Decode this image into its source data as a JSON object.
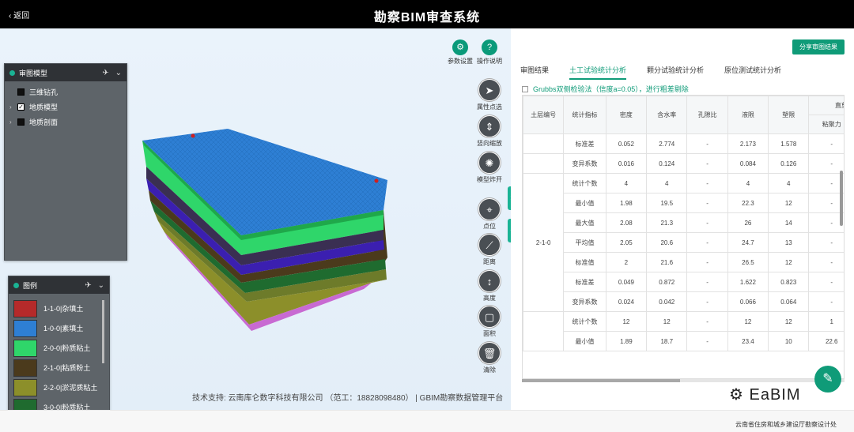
{
  "header": {
    "back_label": "返回",
    "title": "勘察BIM审查系统"
  },
  "model_panel": {
    "title": "审图模型",
    "items": [
      {
        "label": "三维钻孔",
        "checked": false,
        "expandable": false
      },
      {
        "label": "地质模型",
        "checked": true,
        "expandable": true
      },
      {
        "label": "地质剖面",
        "checked": false,
        "expandable": true
      }
    ]
  },
  "legend_panel": {
    "title": "图例",
    "items": [
      {
        "label": "1-1-0|杂填土",
        "color": "#b52a2a"
      },
      {
        "label": "1-0-0|素填土",
        "color": "#2e7fd4"
      },
      {
        "label": "2-0-0|粉质粘土",
        "color": "#2fd66a"
      },
      {
        "label": "2-1-0|粘质粉土",
        "color": "#4b3a1c"
      },
      {
        "label": "2-2-0|淤泥质粘土",
        "color": "#8c8f2a"
      },
      {
        "label": "3-0-0|粉质粘土",
        "color": "#1f6b2f"
      }
    ]
  },
  "toolbar_top": [
    {
      "label": "参数设置",
      "icon": "gear-icon"
    },
    {
      "label": "操作说明",
      "icon": "help-icon"
    }
  ],
  "toolbar": [
    {
      "label": "属性点选",
      "icon": "pointer-icon"
    },
    {
      "label": "竖向缩放",
      "icon": "vertical-scale-icon"
    },
    {
      "label": "模型炸开",
      "icon": "explode-icon"
    },
    {
      "label": "点位",
      "icon": "point-icon"
    },
    {
      "label": "距离",
      "icon": "distance-icon"
    },
    {
      "label": "高度",
      "icon": "height-icon"
    },
    {
      "label": "面积",
      "icon": "area-icon"
    },
    {
      "label": "清除",
      "icon": "trash-icon"
    }
  ],
  "footer_text": "技术支持: 云南库仑数字科技有限公司 （范工：18828098480） | GBIM勘察数据管理平台",
  "right": {
    "share_label": "分享审图结果",
    "tabs": [
      "审图结果",
      "土工试验统计分析",
      "颗分试验统计分析",
      "原位测试统计分析"
    ],
    "active_tab": 1,
    "grubbs_label": "Grubbs双侧检验法（信度a=0.05），进行粗差剔除",
    "table": {
      "headers": [
        "土层编号",
        "统计指标",
        "密度",
        "含水率",
        "孔隙比",
        "液限",
        "塑限",
        "直剪快",
        "粘聚力"
      ],
      "top_rows": [
        [
          "",
          "标准差",
          "0.052",
          "2.774",
          "-",
          "2.173",
          "1.578",
          "-"
        ],
        [
          "",
          "变异系数",
          "0.016",
          "0.124",
          "-",
          "0.084",
          "0.126",
          "-"
        ]
      ],
      "group_label": "2-1-0",
      "group_rows": [
        [
          "统计个数",
          "4",
          "4",
          "-",
          "4",
          "4",
          "-"
        ],
        [
          "最小值",
          "1.98",
          "19.5",
          "-",
          "22.3",
          "12",
          "-"
        ],
        [
          "最大值",
          "2.08",
          "21.3",
          "-",
          "26",
          "14",
          "-"
        ],
        [
          "平均值",
          "2.05",
          "20.6",
          "-",
          "24.7",
          "13",
          "-"
        ],
        [
          "标准值",
          "2",
          "21.6",
          "-",
          "26.5",
          "12",
          "-"
        ],
        [
          "标准差",
          "0.049",
          "0.872",
          "-",
          "1.622",
          "0.823",
          "-"
        ],
        [
          "变异系数",
          "0.024",
          "0.042",
          "-",
          "0.066",
          "0.064",
          "-"
        ]
      ],
      "next_rows": [
        [
          "统计个数",
          "12",
          "12",
          "-",
          "12",
          "12",
          "1"
        ],
        [
          "最小值",
          "1.89",
          "18.7",
          "-",
          "23.4",
          "10",
          "22.6"
        ]
      ]
    }
  },
  "watermark": "EaBIM",
  "bottom_org": "云南省住房和城乡建设厅勘察设计处"
}
